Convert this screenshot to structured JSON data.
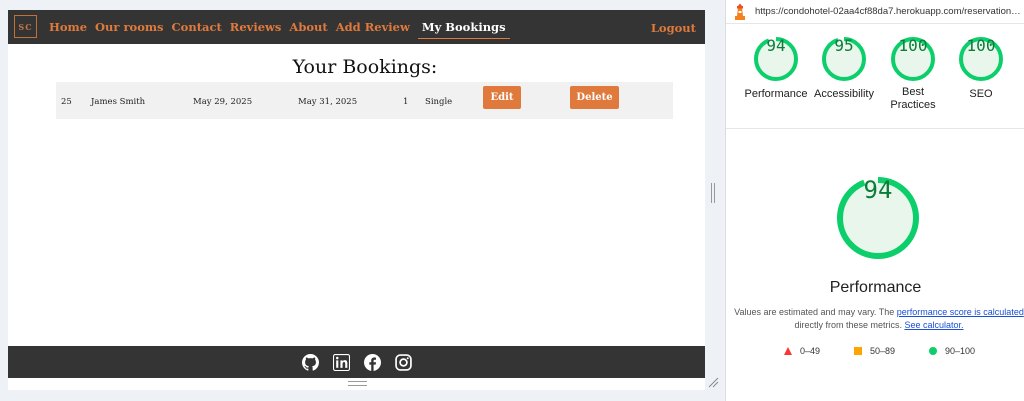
{
  "site": {
    "logo_text": "SC",
    "nav": [
      "Home",
      "Our rooms",
      "Contact",
      "Reviews",
      "About",
      "Add Review"
    ],
    "nav_active": "My Bookings",
    "logout": "Logout",
    "title": "Your Bookings:",
    "booking": {
      "id": "25",
      "name": "James Smith",
      "check_in": "May 29, 2025",
      "check_out": "May 31, 2025",
      "guests": "1",
      "room": "Single",
      "edit_label": "Edit",
      "delete_label": "Delete"
    },
    "social_icons": [
      "github-icon",
      "linkedin-icon",
      "facebook-icon",
      "instagram-icon"
    ]
  },
  "lighthouse": {
    "url": "https://condohotel-02aa4cf88da7.herokuapp.com/reservations/m...",
    "scores": [
      {
        "label": "Performance",
        "value": 94
      },
      {
        "label": "Accessibility",
        "value": 95
      },
      {
        "label": "Best Practices",
        "value": 100
      },
      {
        "label": "SEO",
        "value": 100
      }
    ],
    "main_score": 94,
    "main_title": "Performance",
    "desc_prefix": "Values are estimated and may vary. The ",
    "desc_link1": "performance score is calculated",
    "desc_middle": " directly from these metrics. ",
    "desc_link2": "See calculator.",
    "legend": [
      "0–49",
      "50–89",
      "90–100"
    ],
    "colors": {
      "pass": "#0cce6b",
      "pass_bg": "#e8f6ec",
      "average": "#ffa400",
      "fail": "#ff3333"
    }
  }
}
